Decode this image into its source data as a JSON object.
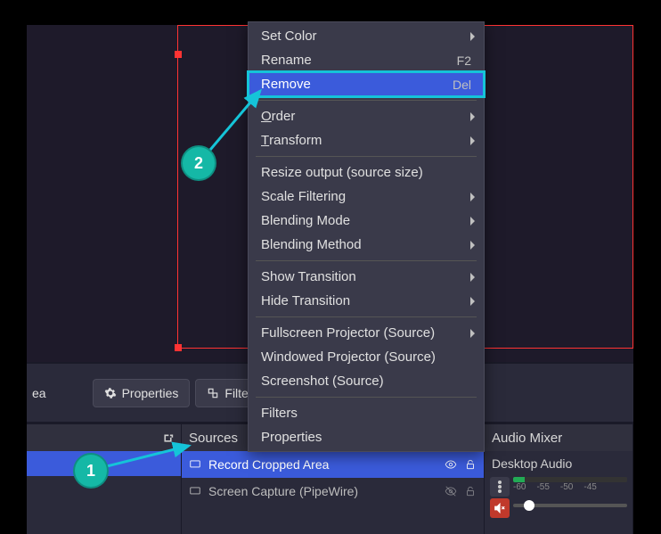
{
  "toolbar": {
    "properties_label": "Properties",
    "filters_label": "Filters",
    "left_frag": "ea"
  },
  "panels": {
    "sources_header": "Sources",
    "mixer_header": "Audio Mixer"
  },
  "sources": [
    {
      "label": "Record Cropped Area",
      "selected": true
    },
    {
      "label": "Screen Capture (PipeWire)",
      "selected": false
    }
  ],
  "mixer": {
    "track_label": "Desktop Audio",
    "ticks": [
      "-60",
      "-55",
      "-50",
      "-45"
    ]
  },
  "context_menu": [
    {
      "label": "Set Color",
      "submenu": true
    },
    {
      "label": "Rename",
      "shortcut": "F2"
    },
    {
      "label": "Remove",
      "shortcut": "Del",
      "active": true,
      "highlight": true
    },
    {
      "sep": true
    },
    {
      "label": "Order",
      "mn": "O",
      "rest": "rder",
      "submenu": true
    },
    {
      "label": "Transform",
      "mn": "T",
      "rest": "ransform",
      "submenu": true
    },
    {
      "sep": true
    },
    {
      "label": "Resize output (source size)"
    },
    {
      "label": "Scale Filtering",
      "submenu": true
    },
    {
      "label": "Blending Mode",
      "submenu": true
    },
    {
      "label": "Blending Method",
      "submenu": true
    },
    {
      "sep": true
    },
    {
      "label": "Show Transition",
      "submenu": true
    },
    {
      "label": "Hide Transition",
      "submenu": true
    },
    {
      "sep": true
    },
    {
      "label": "Fullscreen Projector (Source)",
      "submenu": true
    },
    {
      "label": "Windowed Projector (Source)"
    },
    {
      "label": "Screenshot (Source)"
    },
    {
      "sep": true
    },
    {
      "label": "Filters"
    },
    {
      "label": "Properties"
    }
  ],
  "annotations": {
    "bubble1": "1",
    "bubble2": "2"
  }
}
